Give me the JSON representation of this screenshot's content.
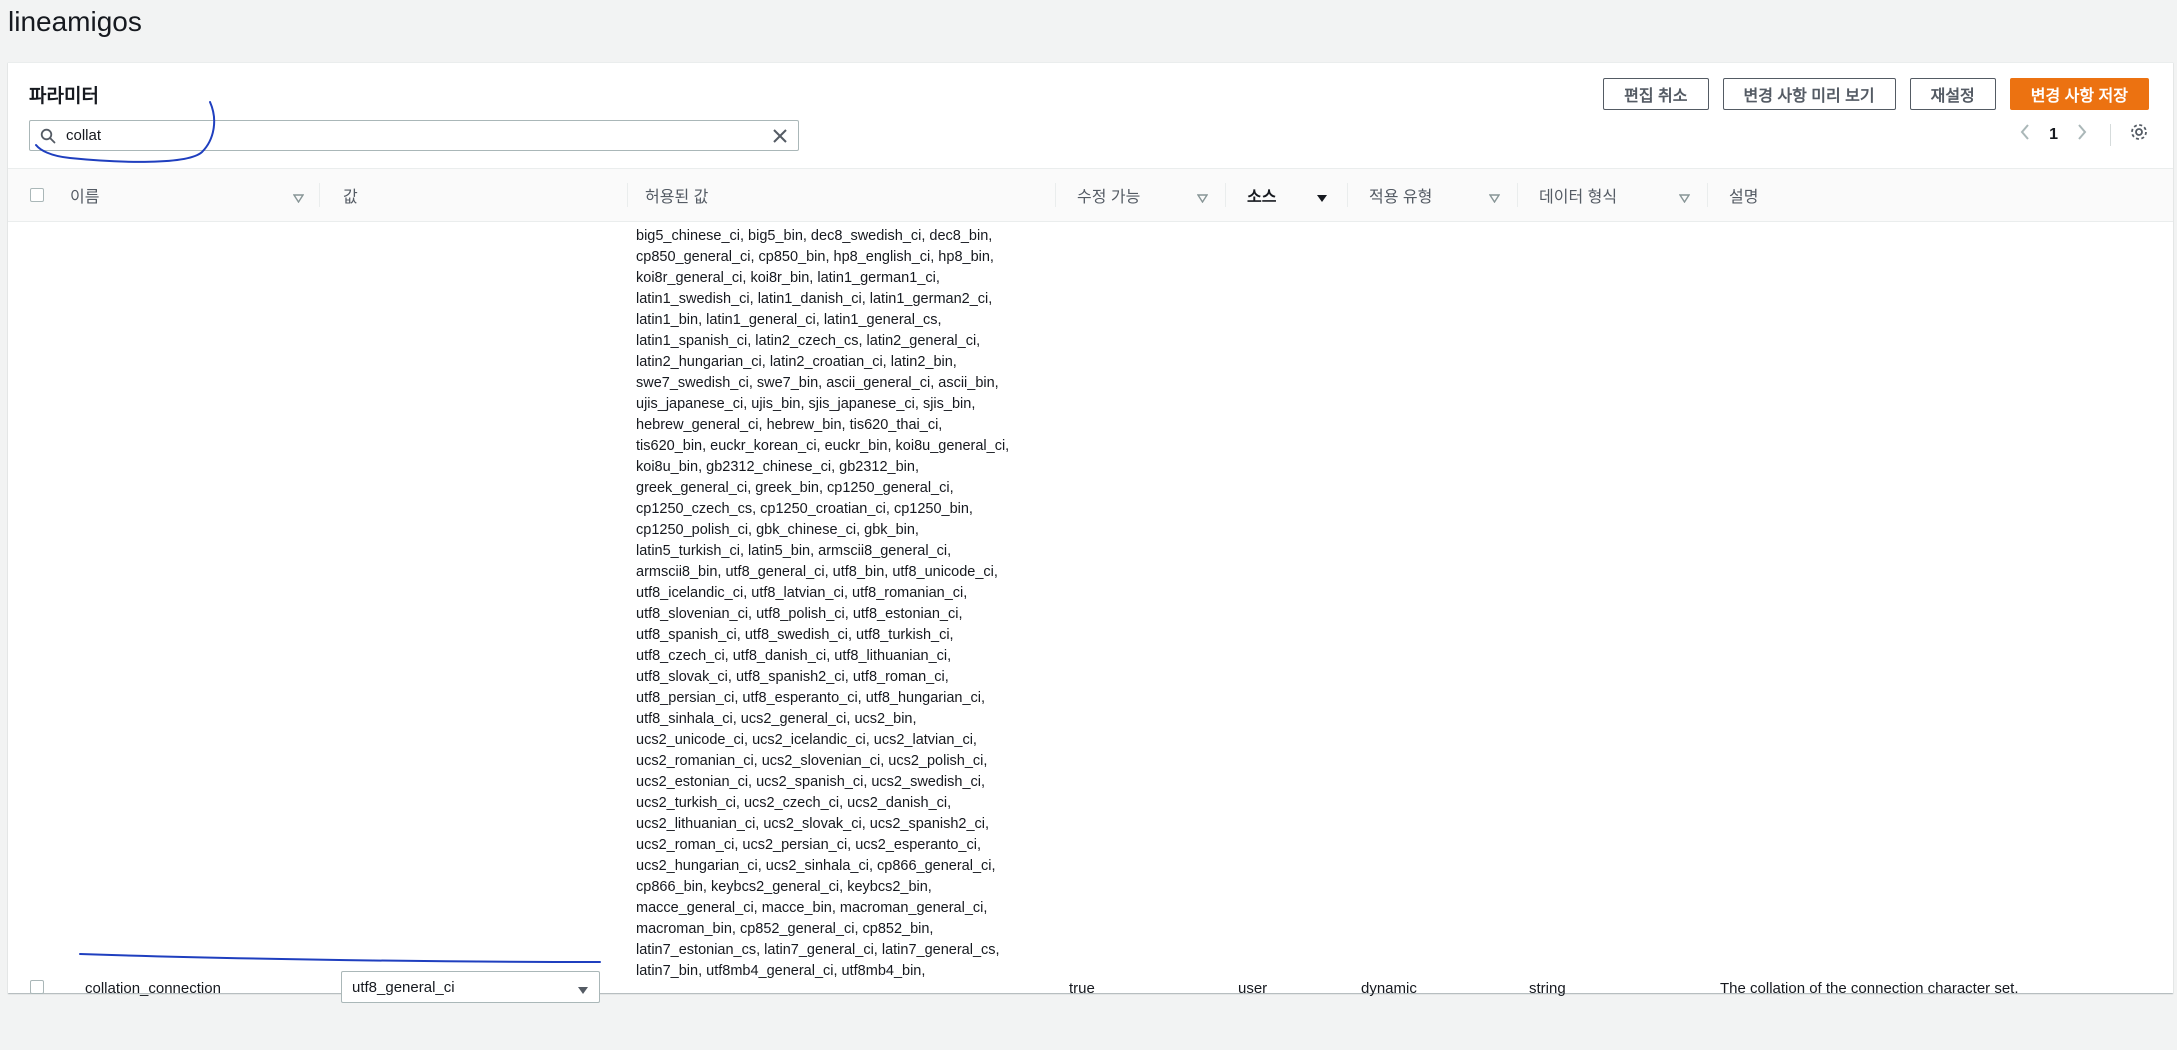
{
  "page": {
    "title": "lineamigos"
  },
  "panel": {
    "title": "파라미터",
    "buttons": {
      "cancel_edit": "편집 취소",
      "preview_changes": "변경 사항 미리 보기",
      "reset": "재설정",
      "save_changes": "변경 사항 저장"
    },
    "search": {
      "value": "collat"
    },
    "pagination": {
      "current_page": "1"
    }
  },
  "table": {
    "columns": {
      "name": "이름",
      "value": "값",
      "allowed_values": "허용된 값",
      "modifiable": "수정 가능",
      "source": "소스",
      "apply_type": "적용 유형",
      "data_type": "데이터 형식",
      "description": "설명"
    },
    "rows": [
      {
        "name": "collation_connection",
        "value": "utf8_general_ci",
        "allowed_values": "big5_chinese_ci, big5_bin, dec8_swedish_ci, dec8_bin,\ncp850_general_ci, cp850_bin, hp8_english_ci, hp8_bin,\nkoi8r_general_ci, koi8r_bin, latin1_german1_ci,\nlatin1_swedish_ci, latin1_danish_ci, latin1_german2_ci,\nlatin1_bin, latin1_general_ci, latin1_general_cs,\nlatin1_spanish_ci, latin2_czech_cs, latin2_general_ci,\nlatin2_hungarian_ci, latin2_croatian_ci, latin2_bin,\nswe7_swedish_ci, swe7_bin, ascii_general_ci, ascii_bin,\nujis_japanese_ci, ujis_bin, sjis_japanese_ci, sjis_bin,\nhebrew_general_ci, hebrew_bin, tis620_thai_ci,\ntis620_bin, euckr_korean_ci, euckr_bin, koi8u_general_ci,\nkoi8u_bin, gb2312_chinese_ci, gb2312_bin,\ngreek_general_ci, greek_bin, cp1250_general_ci,\ncp1250_czech_cs, cp1250_croatian_ci, cp1250_bin,\ncp1250_polish_ci, gbk_chinese_ci, gbk_bin,\nlatin5_turkish_ci, latin5_bin, armscii8_general_ci,\narmscii8_bin, utf8_general_ci, utf8_bin, utf8_unicode_ci,\nutf8_icelandic_ci, utf8_latvian_ci, utf8_romanian_ci,\nutf8_slovenian_ci, utf8_polish_ci, utf8_estonian_ci,\nutf8_spanish_ci, utf8_swedish_ci, utf8_turkish_ci,\nutf8_czech_ci, utf8_danish_ci, utf8_lithuanian_ci,\nutf8_slovak_ci, utf8_spanish2_ci, utf8_roman_ci,\nutf8_persian_ci, utf8_esperanto_ci, utf8_hungarian_ci,\nutf8_sinhala_ci, ucs2_general_ci, ucs2_bin,\nucs2_unicode_ci, ucs2_icelandic_ci, ucs2_latvian_ci,\nucs2_romanian_ci, ucs2_slovenian_ci, ucs2_polish_ci,\nucs2_estonian_ci, ucs2_spanish_ci, ucs2_swedish_ci,\nucs2_turkish_ci, ucs2_czech_ci, ucs2_danish_ci,\nucs2_lithuanian_ci, ucs2_slovak_ci, ucs2_spanish2_ci,\nucs2_roman_ci, ucs2_persian_ci, ucs2_esperanto_ci,\nucs2_hungarian_ci, ucs2_sinhala_ci, cp866_general_ci,\ncp866_bin, keybcs2_general_ci, keybcs2_bin,\nmacce_general_ci, macce_bin, macroman_general_ci,\nmacroman_bin, cp852_general_ci, cp852_bin,\nlatin7_estonian_cs, latin7_general_ci, latin7_general_cs,\nlatin7_bin, utf8mb4_general_ci, utf8mb4_bin,",
        "modifiable": "true",
        "source": "user",
        "apply_type": "dynamic",
        "data_type": "string",
        "description": "The collation of the connection character set."
      }
    ]
  },
  "colors": {
    "accent": "#ec7211",
    "annotation_ink": "#1f3fbf",
    "border": "#aab7b8",
    "text": "#16191f",
    "muted": "#545b64"
  },
  "icons": {
    "search": "search-icon",
    "clear": "close-icon",
    "prev": "chevron-left-icon",
    "next": "chevron-right-icon",
    "settings": "gear-icon",
    "sort": "caret-down-icon",
    "dropdown": "caret-down-icon"
  }
}
